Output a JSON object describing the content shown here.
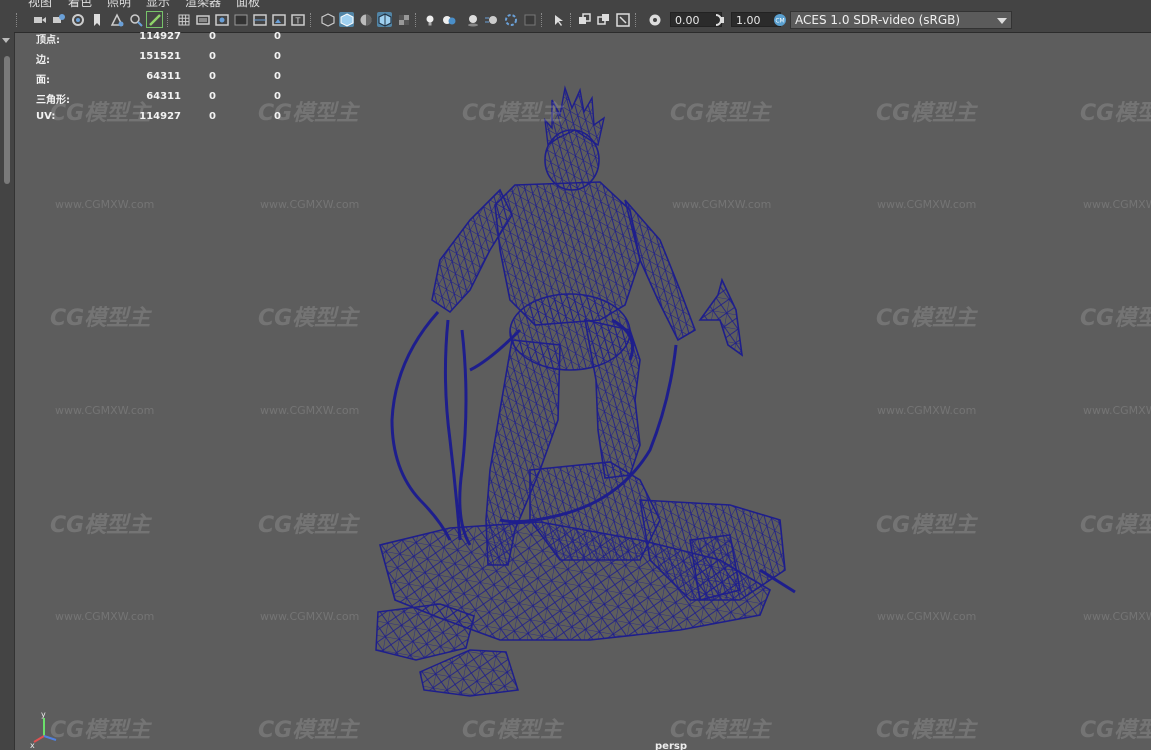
{
  "menu": [
    "视图",
    "着色",
    "照明",
    "显示",
    "渲染器",
    "面板"
  ],
  "toolbar": {
    "camera_value": "0.00",
    "gamma_value": "1.00",
    "color_management": "ACES 1.0 SDR-video (sRGB)",
    "icons": [
      "camera-select-icon",
      "camera-attributes-icon",
      "bookmark-icon",
      "image-plane-icon",
      "2d-pan-zoom-icon",
      "grease-pencil-icon",
      "grid-icon",
      "film-gate-icon",
      "resolution-gate-icon",
      "gate-mask-icon",
      "field-chart-icon",
      "safe-action-icon",
      "safe-title-icon",
      "wireframe-icon",
      "smooth-shade-icon",
      "use-default-material-icon",
      "wireframe-on-shaded-icon",
      "xray-icon",
      "use-all-lights-icon",
      "shadows-icon",
      "screen-space-ao-icon",
      "motion-blur-icon",
      "multisample-icon",
      "depth-of-field-icon",
      "isolate-select-icon",
      "xray-joints-icon",
      "xray-active-icon",
      "exposure-icon",
      "gamma-icon",
      "color-management-icon"
    ],
    "accent": "#5285a6"
  },
  "hud": {
    "rows": [
      {
        "label": "顶点:",
        "v1": "114927",
        "v2": "0",
        "v3": "0"
      },
      {
        "label": "边:",
        "v1": "151521",
        "v2": "0",
        "v3": "0"
      },
      {
        "label": "面:",
        "v1": "64311",
        "v2": "0",
        "v3": "0"
      },
      {
        "label": "三角形:",
        "v1": "64311",
        "v2": "0",
        "v3": "0"
      },
      {
        "label": "UV:",
        "v1": "114927",
        "v2": "0",
        "v3": "0"
      }
    ],
    "camera": "persp"
  },
  "axis": {
    "y": "y",
    "x": "x"
  },
  "watermark": {
    "logo": "CG模型主",
    "url": "www.CGMXW.com"
  },
  "model": {
    "wire_color": "#1e1e8c"
  }
}
